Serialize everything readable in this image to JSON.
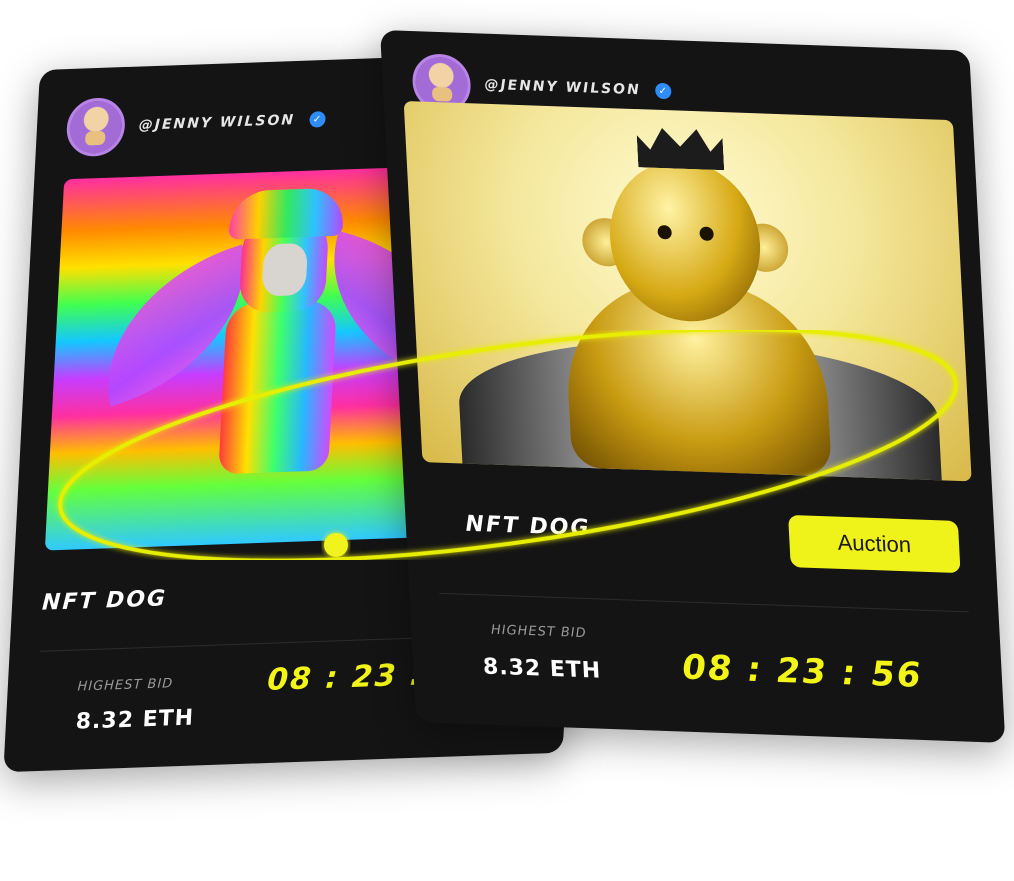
{
  "cards": [
    {
      "username": "@JENNY WILSON",
      "title": "NFT DOG",
      "bid_label": "HIGHEST BID",
      "bid_value": "8.32 ETH",
      "timer": "08 : 23 :"
    },
    {
      "username": "@JENNY WILSON",
      "title": "NFT DOG",
      "button": "Auction",
      "bid_label": "HIGHEST BID",
      "bid_value": "8.32 ETH",
      "timer": "08 : 23 : 56"
    }
  ],
  "colors": {
    "card_bg": "#141414",
    "accent": "#f0f31a",
    "verified": "#2f8cff"
  },
  "icons": {
    "verified": "check-badge-icon",
    "avatar": "avatar-icon"
  }
}
